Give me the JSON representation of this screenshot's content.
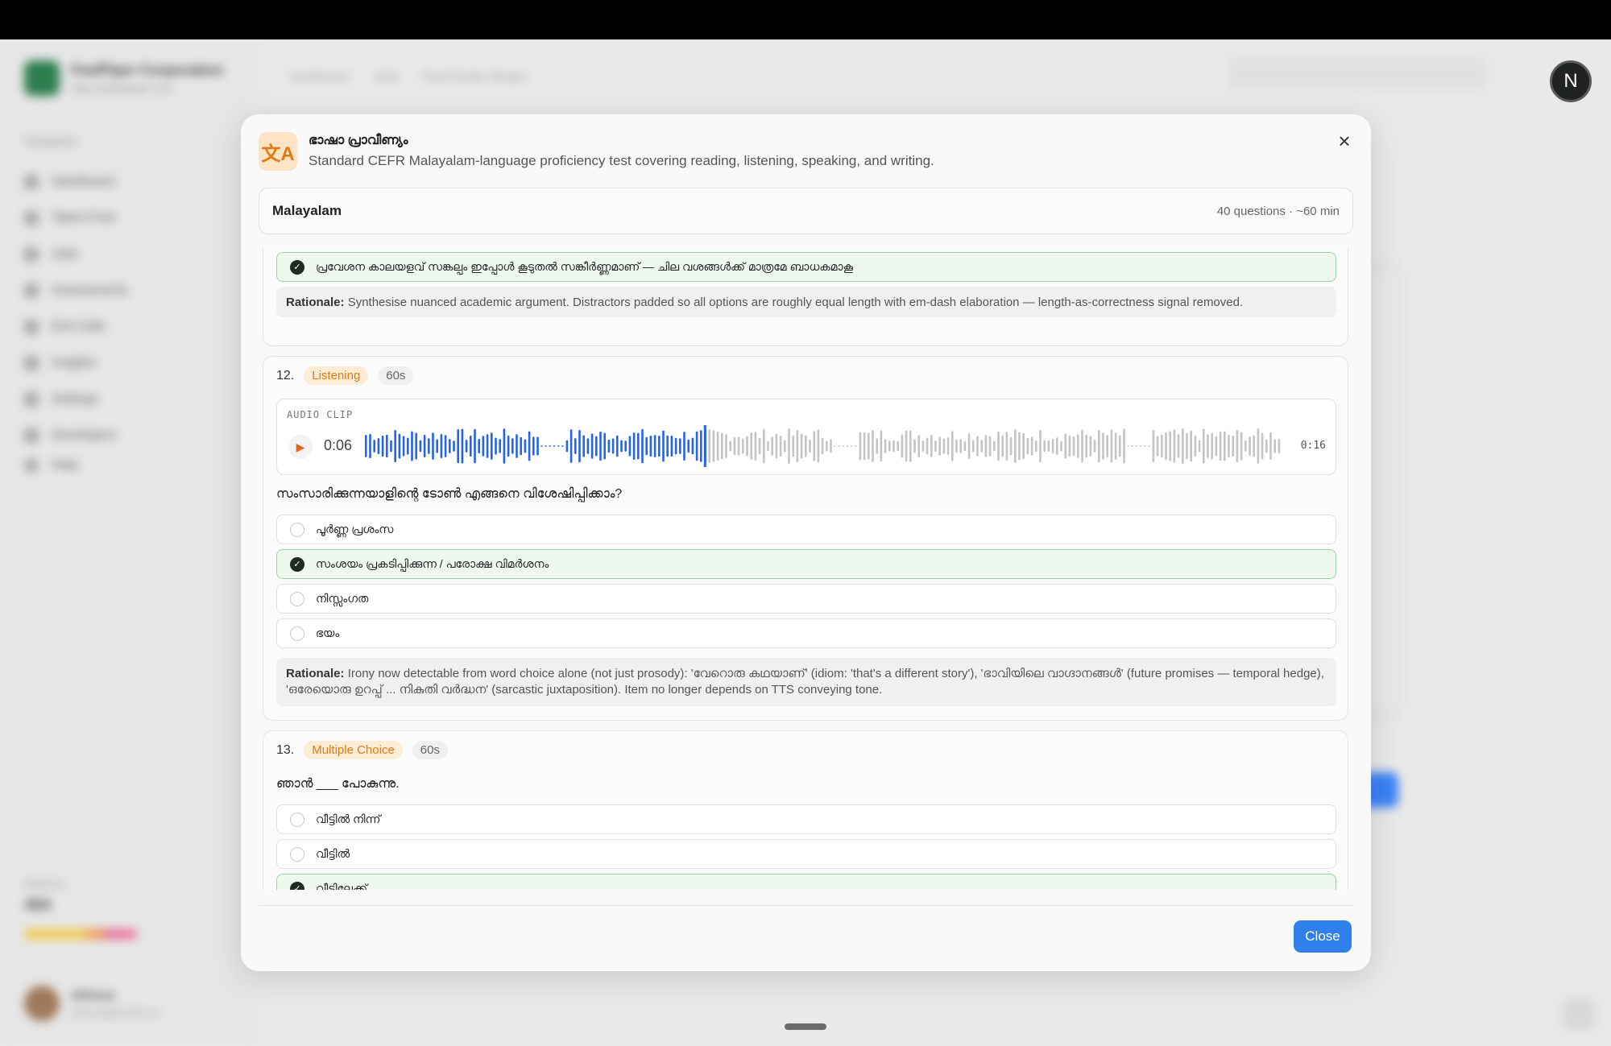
{
  "app": {
    "brand_name": "FeelPiper Corporation",
    "brand_url": "https://pixelpaper.com",
    "nav_label": "Navigation",
    "nav_items": [
      "Dashboard",
      "Talent Pool",
      "Jobs",
      "Assessments",
      "Exit Calls",
      "Insights",
      "Settings",
      "Developers"
    ],
    "help": "Help",
    "balance_label": "Balance",
    "balance_value": "484",
    "user_name": "Athena",
    "user_email": "athena@pixelfox.io",
    "breadcrumbs": [
      "Dashboard",
      "Jobs",
      "Real Estate Slinger"
    ],
    "avatar_initial": "N"
  },
  "modal": {
    "icon": "文A",
    "title": "ഭാഷാ പ്രാവീണ്യം",
    "subtitle": "Standard CEFR Malayalam-language proficiency test covering reading, listening, speaking, and writing.",
    "language": "Malayalam",
    "meta": "40 questions · ~60 min",
    "close_label": "Close"
  },
  "prev_question": {
    "correct_option": "പ്രവേശന കാലയളവ് സങ്കല്പം ഇപ്പോൾ കൂടുതൽ സങ്കീർണ്ണമാണ് — ചില വശങ്ങൾക്ക് മാത്രമേ ബാധകമാകൂ",
    "rationale_label": "Rationale:",
    "rationale": "Synthesise nuanced academic argument. Distractors padded so all options are roughly equal length with em-dash elaboration — length-as-correctness signal removed."
  },
  "q12": {
    "number": "12.",
    "type": "Listening",
    "time": "60s",
    "audio_label": "AUDIO CLIP",
    "current_time": "0:06",
    "total_time": "0:16",
    "progress": 0.37,
    "question": "സംസാരിക്കുന്നയാളിന്റെ ടോൺ എങ്ങനെ വിശേഷിപ്പിക്കാം?",
    "options": [
      {
        "text": "പൂർണ്ണ പ്രശംസ",
        "correct": false
      },
      {
        "text": "സംശയം പ്രകടിപ്പിക്കുന്ന / പരോക്ഷ വിമർശനം",
        "correct": true
      },
      {
        "text": "നിസ്സംഗത",
        "correct": false
      },
      {
        "text": "ഭയം",
        "correct": false
      }
    ],
    "rationale_label": "Rationale:",
    "rationale": "Irony now detectable from word choice alone (not just prosody): 'വേറൊരു കഥയാണ്' (idiom: 'that's a different story'), 'ഭാവിയിലെ വാഗ്ദാനങ്ങൾ' (future promises — temporal hedge), 'ഒരേയൊരു ഉറപ്പ് ... നികുതി വർദ്ധന' (sarcastic juxtaposition). Item no longer depends on TTS conveying tone."
  },
  "q13": {
    "number": "13.",
    "type": "Multiple Choice",
    "time": "60s",
    "question": "ഞാൻ ___ പോകുന്നു.",
    "options": [
      {
        "text": "വീട്ടിൽ നിന്ന്",
        "correct": false
      },
      {
        "text": "വീട്ടിൽ",
        "correct": false
      },
      {
        "text": "വീട്ടിലേക്ക്",
        "correct": true
      }
    ]
  },
  "colors": {
    "accent_blue": "#2f80ed",
    "wave_played": "#2563eb",
    "wave_unplayed": "#c4c4c4",
    "badge_orange": "#e07a14",
    "correct_green": "#9ed3a6"
  }
}
